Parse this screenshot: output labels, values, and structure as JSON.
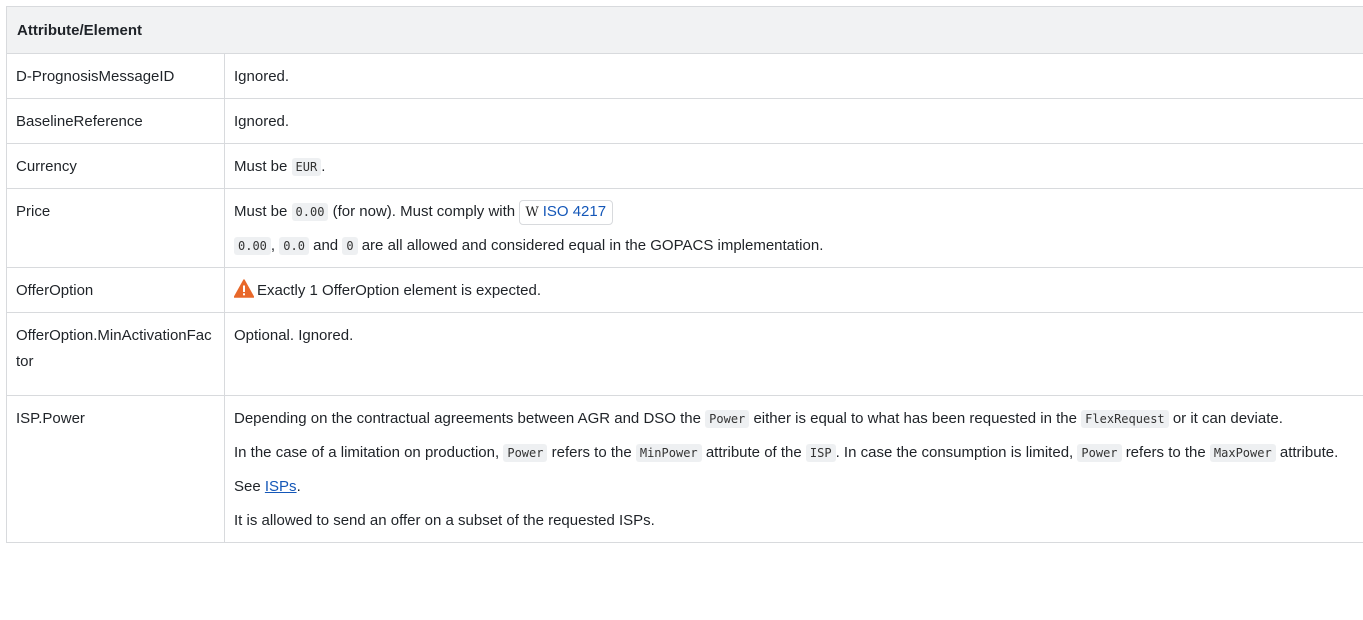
{
  "header": "Attribute/Element",
  "rows": {
    "prognosis": {
      "name": "D-PrognosisMessageID",
      "desc": "Ignored."
    },
    "baseline": {
      "name": "BaselineReference",
      "desc": "Ignored."
    },
    "currency": {
      "name": "Currency",
      "pre": "Must be",
      "code": "EUR",
      "post": "."
    },
    "price": {
      "name": "Price",
      "p1_pre": "Must be",
      "p1_code": "0.00",
      "p1_mid": "(for now). Must comply with",
      "wiki_letter": "W",
      "wiki_link": "ISO 4217",
      "p2_code1": "0.00",
      "p2_sep1": ",",
      "p2_code2": "0.0",
      "p2_and": "and",
      "p2_code3": "0",
      "p2_post": "are all allowed and considered equal in the GOPACS implementation."
    },
    "offeroption": {
      "name": "OfferOption",
      "icon": "warning-icon",
      "desc": "Exactly 1 OfferOption element is expected."
    },
    "minactivation": {
      "name": "OfferOption.MinActivationFactor",
      "desc": "Optional. Ignored."
    },
    "isppower": {
      "name": "ISP.Power",
      "p1_a": "Depending on the contractual agreements between AGR and DSO the",
      "p1_code1": "Power",
      "p1_b": "either is equal to what has been requested in the",
      "p1_code2": "FlexRequest",
      "p1_c": "or it can deviate.",
      "p2_a": "In the case of a limitation on production,",
      "p2_code1": "Power",
      "p2_b": "refers to the",
      "p2_code2": "MinPower",
      "p2_c": "attribute of the",
      "p2_code3": "ISP",
      "p2_d": ". In case the consumption is limited,",
      "p2_code4": "Power",
      "p2_e": "refers to the",
      "p2_code5": "MaxPower",
      "p2_f": "attribute.",
      "p3_pre": "See",
      "p3_link": "ISPs",
      "p3_post": ".",
      "p4": "It is allowed to send an offer on a subset of the requested ISPs."
    }
  },
  "colors": {
    "header_bg": "#f1f2f3",
    "border": "#d8dadd",
    "link": "#1457b8",
    "warning": "#e8682a"
  }
}
